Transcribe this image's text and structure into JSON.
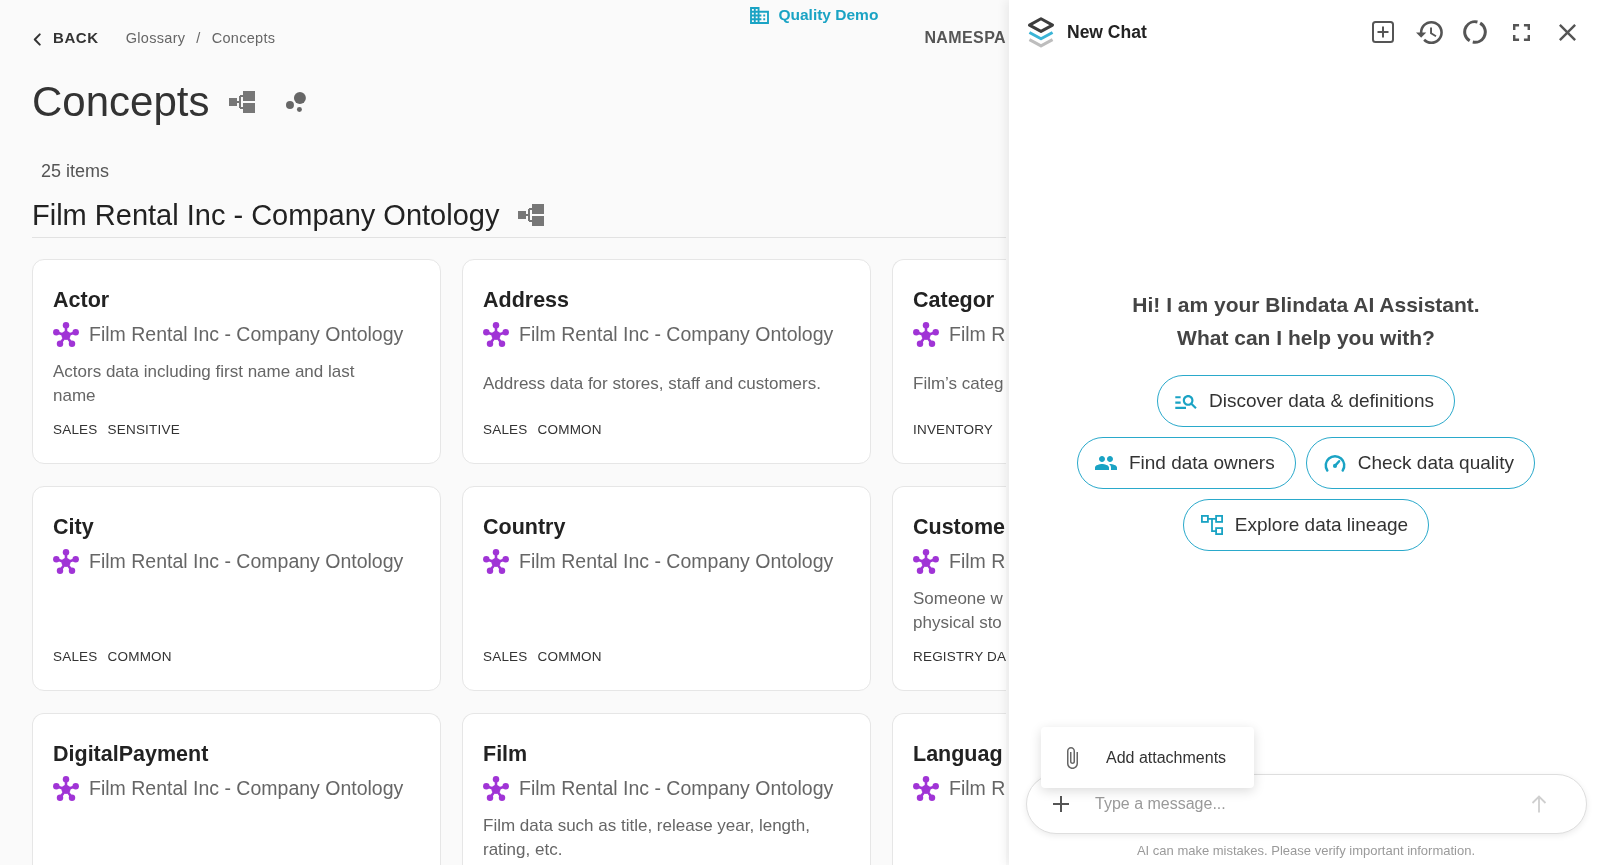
{
  "top_bar": {
    "back_label": "BACK",
    "breadcrumbs": [
      "Glossary",
      "Concepts"
    ],
    "breadcrumb_separator": "/",
    "tenant": "Quality Demo",
    "namespace_label": "NAMESPA"
  },
  "page": {
    "title": "Concepts",
    "item_count": "25 items"
  },
  "group": {
    "title": "Film Rental Inc - Company Ontology"
  },
  "cards": [
    {
      "title": "Actor",
      "ontology": "Film Rental Inc - Company Ontology",
      "description": "Actors data including first name and last name",
      "tags": [
        "SALES",
        "SENSITIVE"
      ]
    },
    {
      "title": "Address",
      "ontology": "Film Rental Inc - Company Ontology",
      "description": "Address data for stores, staff and customers.",
      "tags": [
        "SALES",
        "COMMON"
      ]
    },
    {
      "title": "Categor",
      "ontology": "Film R",
      "description": "Film’s categ",
      "tags": [
        "INVENTORY"
      ]
    },
    {
      "title": "City",
      "ontology": "Film Rental Inc - Company Ontology",
      "tags": [
        "SALES",
        "COMMON"
      ]
    },
    {
      "title": "Country",
      "ontology": "Film Rental Inc - Company Ontology",
      "tags": [
        "SALES",
        "COMMON"
      ]
    },
    {
      "title": "Custome",
      "ontology": "Film R",
      "description": "Someone w\nphysical sto",
      "tags": [
        "REGISTRY DA"
      ]
    },
    {
      "title": "DigitalPayment",
      "ontology": "Film Rental Inc - Company Ontology"
    },
    {
      "title": "Film",
      "ontology": "Film Rental Inc - Company Ontology",
      "description": "Film data such as title, release year, length, rating, etc."
    },
    {
      "title": "Languag",
      "ontology": "Film R"
    }
  ],
  "chat": {
    "title": "New Chat",
    "greeting": "Hi! I am your Blindata AI Assistant.\nWhat can I help you with?",
    "suggestion_rows": [
      [
        {
          "kind": "discover",
          "label": "Discover data & definitions"
        }
      ],
      [
        {
          "kind": "owners",
          "label": "Find data owners"
        },
        {
          "kind": "quality",
          "label": "Check data quality"
        }
      ],
      [
        {
          "kind": "lineage",
          "label": "Explore data lineage"
        }
      ]
    ],
    "attach_menu": {
      "open": true,
      "items": [
        "Add attachments"
      ]
    },
    "composer": {
      "placeholder": "Type a message...",
      "send_disabled": true
    },
    "disclaimer": "AI can make mistakes. Please verify important information."
  }
}
